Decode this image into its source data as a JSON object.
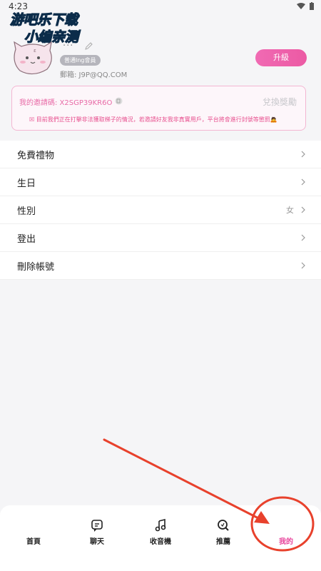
{
  "status_bar": {
    "time": "4:23"
  },
  "watermark": {
    "line1": "游吧乐下载",
    "line2": "小编亲测"
  },
  "profile": {
    "username": "···",
    "member_badge": "普通Ing會員",
    "email": "郵箱: J9P@QQ.COM",
    "upgrade_label": "升級"
  },
  "invite": {
    "code_text": "我的邀請碼: X2SGP39KR6O",
    "redeem_label": "兌換獎勵",
    "notice": "☒ 目前我們正在打擊非法獲取梯子的情況，若邀請好友我非真實用戶，平台將會進行封號等懲罰🙇"
  },
  "menu": {
    "items": [
      {
        "label": "免費禮物",
        "value": ""
      },
      {
        "label": "生日",
        "value": ""
      },
      {
        "label": "性別",
        "value": "女"
      },
      {
        "label": "登出",
        "value": ""
      },
      {
        "label": "刪除帳號",
        "value": ""
      }
    ]
  },
  "tabs": [
    {
      "label": "首頁",
      "icon": "home-icon"
    },
    {
      "label": "聊天",
      "icon": "chat-icon"
    },
    {
      "label": "收音機",
      "icon": "music-icon"
    },
    {
      "label": "推薦",
      "icon": "search-icon"
    },
    {
      "label": "我的",
      "icon": "profile-icon",
      "active": true
    }
  ],
  "colors": {
    "accent": "#e8459c",
    "annotation": "#e8412c"
  }
}
